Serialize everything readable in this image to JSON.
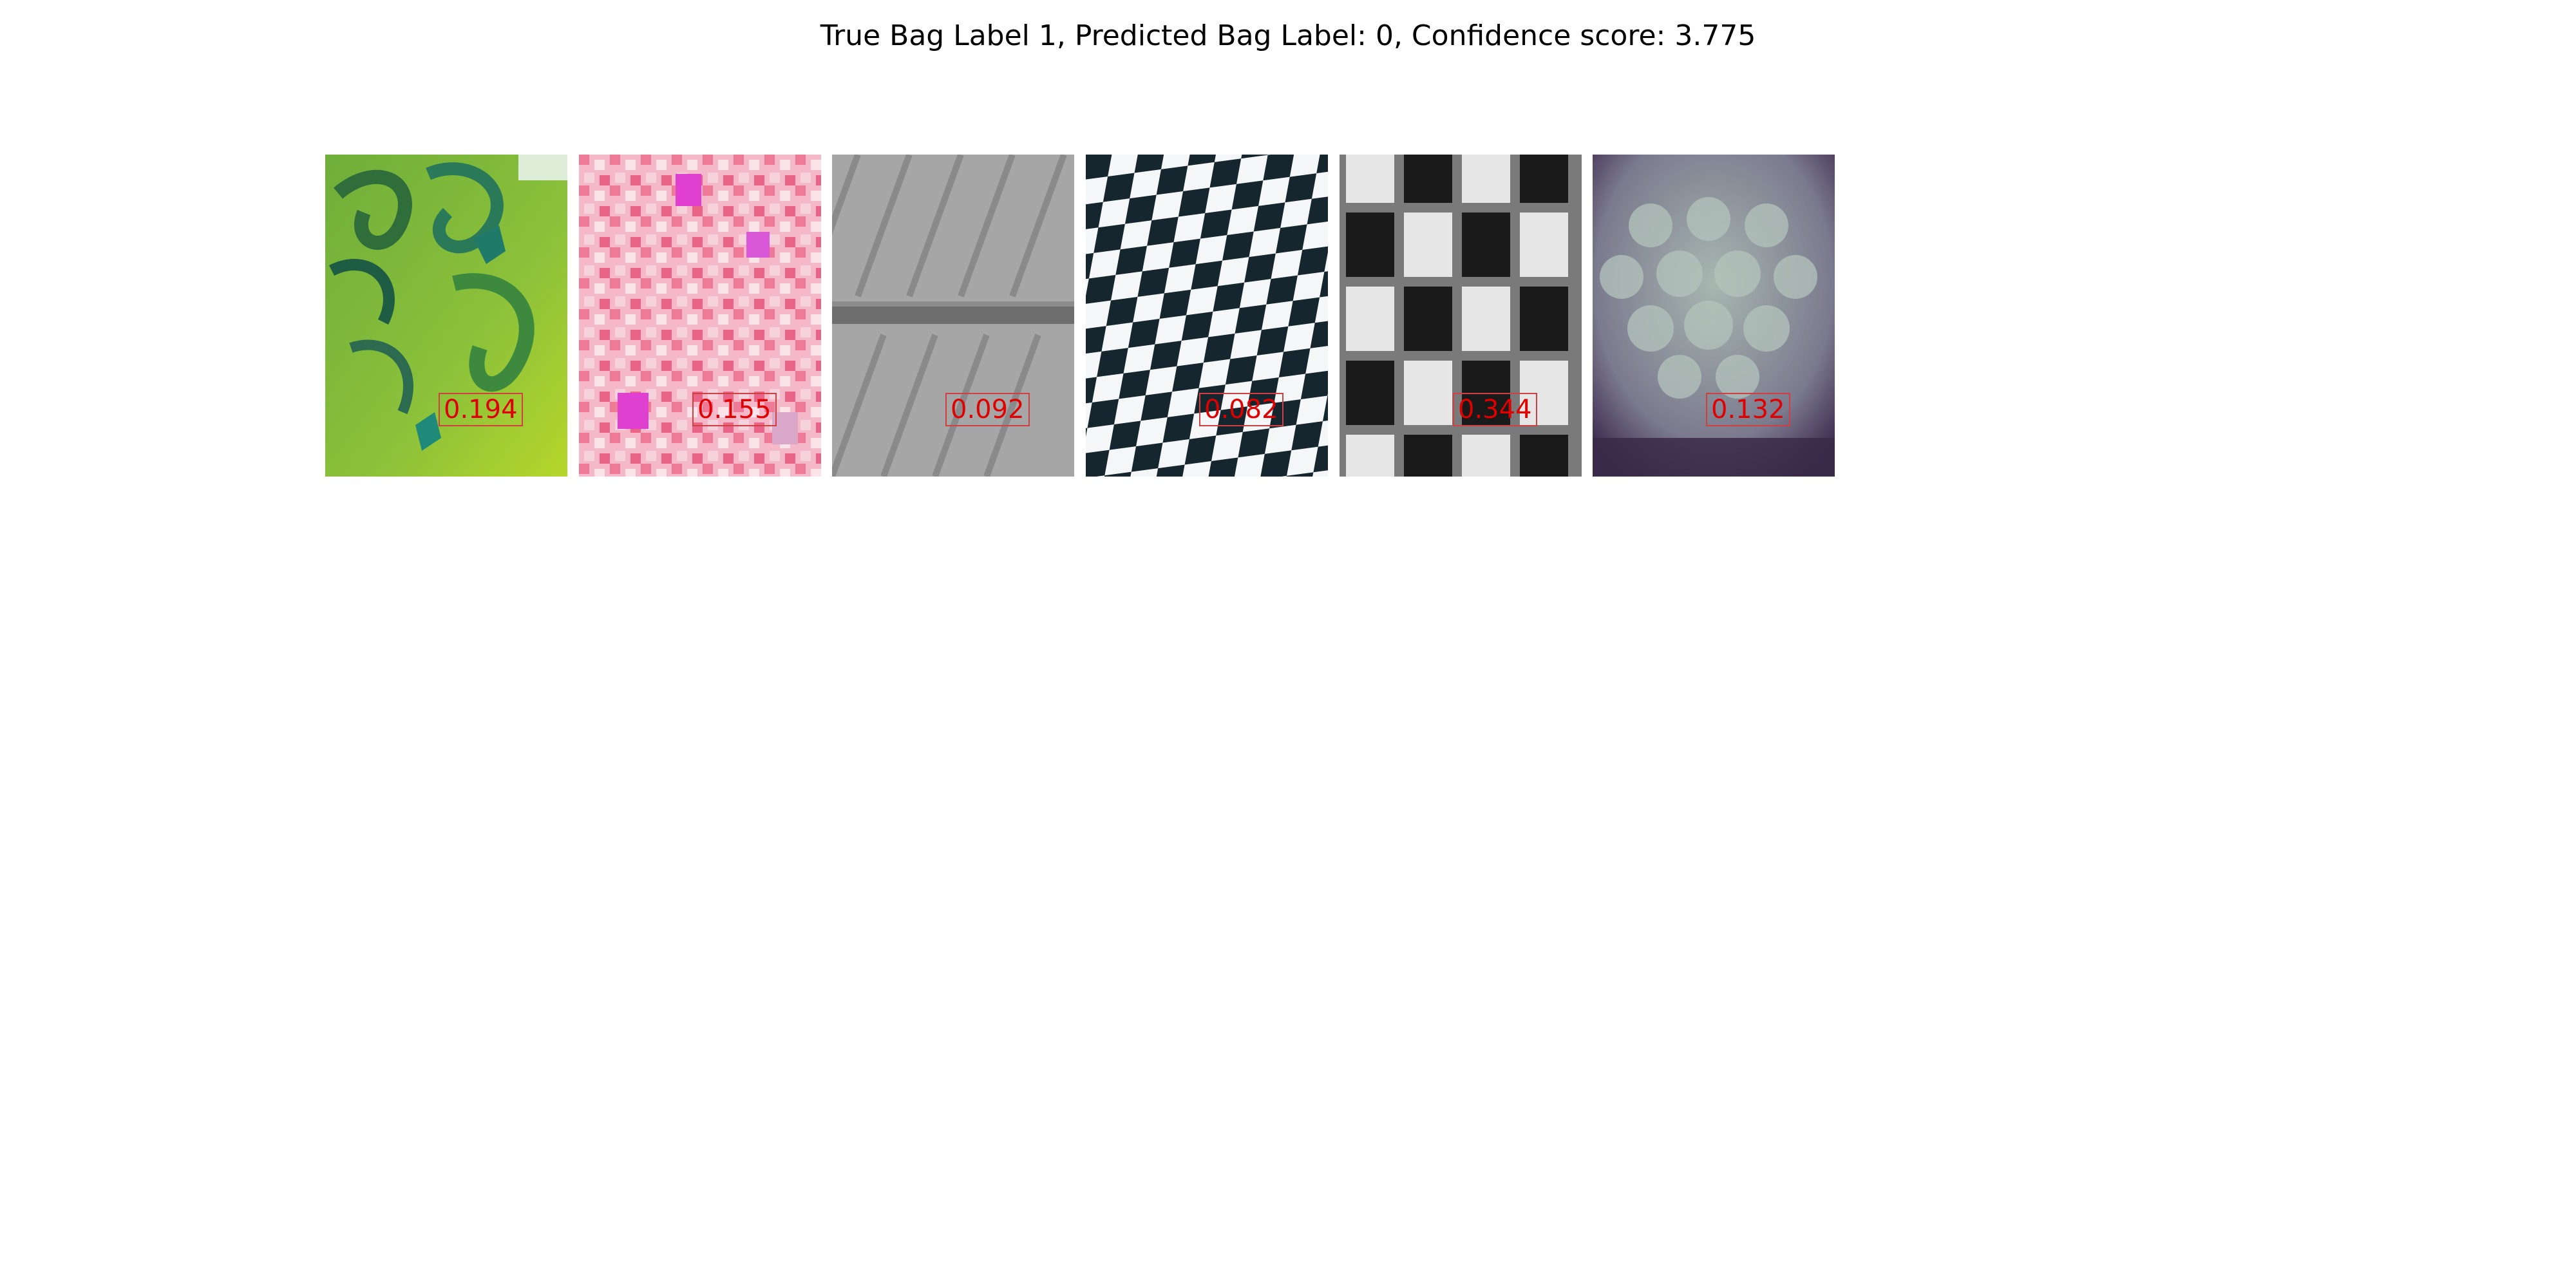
{
  "figure": {
    "title": "True Bag Label 1, Predicted Bag Label: 0, Confidence score: 3.775"
  },
  "instances": [
    {
      "texture": "green-swirl-fabric",
      "score": "0.194"
    },
    {
      "texture": "pink-speckled-pattern",
      "score": "0.155"
    },
    {
      "texture": "gray-striated-surface",
      "score": "0.092"
    },
    {
      "texture": "warped-checkerboard",
      "score": "0.082"
    },
    {
      "texture": "black-white-checkerboard",
      "score": "0.344"
    },
    {
      "texture": "purple-honeycomb",
      "score": "0.132"
    }
  ],
  "colors": {
    "score_text": "#e00000"
  }
}
